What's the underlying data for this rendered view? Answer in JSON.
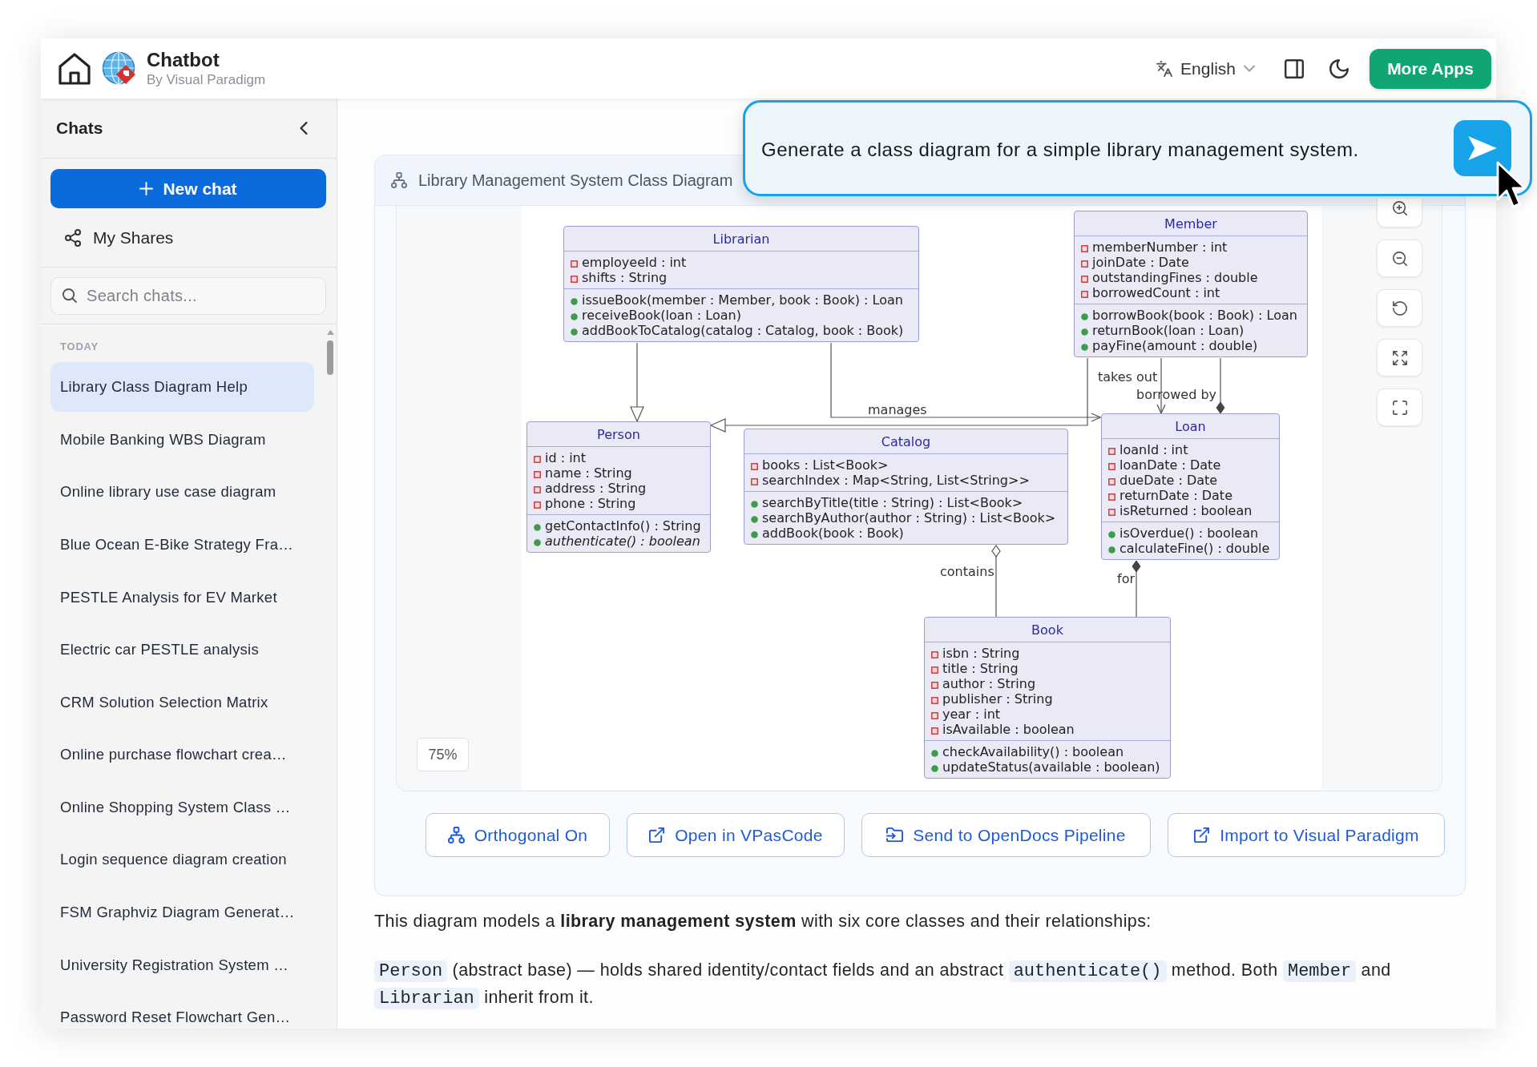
{
  "header": {
    "title": "Chatbot",
    "subtitle": "By Visual Paradigm",
    "language": "English",
    "more_apps": "More Apps"
  },
  "sidebar": {
    "title": "Chats",
    "new_chat": "New chat",
    "my_shares": "My Shares",
    "search": {
      "placeholder": "Search chats..."
    },
    "section": "TODAY",
    "items": [
      {
        "label": "Library Class Diagram Help",
        "selected": true
      },
      {
        "label": "Mobile Banking WBS Diagram",
        "selected": false
      },
      {
        "label": "Online library use case diagram",
        "selected": false
      },
      {
        "label": "Blue Ocean E-Bike Strategy Fra…",
        "selected": false
      },
      {
        "label": "PESTLE Analysis for EV Market",
        "selected": false
      },
      {
        "label": "Electric car PESTLE analysis",
        "selected": false
      },
      {
        "label": "CRM Solution Selection Matrix",
        "selected": false
      },
      {
        "label": "Online purchase flowchart crea…",
        "selected": false
      },
      {
        "label": "Online Shopping System Class …",
        "selected": false
      },
      {
        "label": "Login sequence diagram creation",
        "selected": false
      },
      {
        "label": "FSM Graphviz Diagram Generat…",
        "selected": false
      },
      {
        "label": "University Registration System …",
        "selected": false
      },
      {
        "label": "Password Reset Flowchart Gen…",
        "selected": false
      }
    ]
  },
  "prompt": {
    "text": "Generate a class diagram for a simple library management system."
  },
  "diagram": {
    "title": "Library Management System Class Diagram",
    "zoom": "75%",
    "classes": [
      {
        "name": "Librarian",
        "attributes": [
          {
            "text": "employeeId : int",
            "kind": "private"
          },
          {
            "text": "shifts : String",
            "kind": "private"
          }
        ],
        "methods": [
          {
            "text": "issueBook(member : Member, book : Book) : Loan",
            "kind": "public",
            "abstract": false
          },
          {
            "text": "receiveBook(loan : Loan)",
            "kind": "public",
            "abstract": false
          },
          {
            "text": "addBookToCatalog(catalog : Catalog, book : Book)",
            "kind": "public",
            "abstract": false
          }
        ]
      },
      {
        "name": "Member",
        "attributes": [
          {
            "text": "memberNumber : int",
            "kind": "private"
          },
          {
            "text": "joinDate : Date",
            "kind": "private"
          },
          {
            "text": "outstandingFines : double",
            "kind": "private"
          },
          {
            "text": "borrowedCount : int",
            "kind": "private"
          }
        ],
        "methods": [
          {
            "text": "borrowBook(book : Book) : Loan",
            "kind": "public",
            "abstract": false
          },
          {
            "text": "returnBook(loan : Loan)",
            "kind": "public",
            "abstract": false
          },
          {
            "text": "payFine(amount : double)",
            "kind": "public",
            "abstract": false
          }
        ]
      },
      {
        "name": "Person",
        "attributes": [
          {
            "text": "id : int",
            "kind": "private"
          },
          {
            "text": "name : String",
            "kind": "private"
          },
          {
            "text": "address : String",
            "kind": "private"
          },
          {
            "text": "phone : String",
            "kind": "private"
          }
        ],
        "methods": [
          {
            "text": "getContactInfo() : String",
            "kind": "public",
            "abstract": false
          },
          {
            "text": "authenticate() : boolean",
            "kind": "public",
            "abstract": true
          }
        ]
      },
      {
        "name": "Catalog",
        "attributes": [
          {
            "text": "books : List<Book>",
            "kind": "private"
          },
          {
            "text": "searchIndex : Map<String, List<String>>",
            "kind": "private"
          }
        ],
        "methods": [
          {
            "text": "searchByTitle(title : String) : List<Book>",
            "kind": "public",
            "abstract": false
          },
          {
            "text": "searchByAuthor(author : String) : List<Book>",
            "kind": "public",
            "abstract": false
          },
          {
            "text": "addBook(book : Book)",
            "kind": "public",
            "abstract": false
          }
        ]
      },
      {
        "name": "Loan",
        "attributes": [
          {
            "text": "loanId : int",
            "kind": "private"
          },
          {
            "text": "loanDate : Date",
            "kind": "private"
          },
          {
            "text": "dueDate : Date",
            "kind": "private"
          },
          {
            "text": "returnDate : Date",
            "kind": "private"
          },
          {
            "text": "isReturned : boolean",
            "kind": "private"
          }
        ],
        "methods": [
          {
            "text": "isOverdue() : boolean",
            "kind": "public",
            "abstract": false
          },
          {
            "text": "calculateFine() : double",
            "kind": "public",
            "abstract": false
          }
        ]
      },
      {
        "name": "Book",
        "attributes": [
          {
            "text": "isbn : String",
            "kind": "private"
          },
          {
            "text": "title : String",
            "kind": "private"
          },
          {
            "text": "author : String",
            "kind": "private"
          },
          {
            "text": "publisher : String",
            "kind": "private"
          },
          {
            "text": "year : int",
            "kind": "private"
          },
          {
            "text": "isAvailable : boolean",
            "kind": "private"
          }
        ],
        "methods": [
          {
            "text": "checkAvailability() : boolean",
            "kind": "public",
            "abstract": false
          },
          {
            "text": "updateStatus(available : boolean)",
            "kind": "public",
            "abstract": false
          }
        ]
      }
    ],
    "relations": [
      {
        "kind": "generalization"
      },
      {
        "kind": "generalization"
      },
      {
        "kind": "association",
        "label": "manages"
      },
      {
        "kind": "association",
        "label": "takes out"
      },
      {
        "kind": "composition",
        "label": "borrowed by"
      },
      {
        "kind": "aggregation",
        "label": "contains"
      },
      {
        "kind": "composition",
        "label": "for"
      }
    ],
    "actions": [
      "Orthogonal On",
      "Open in VPasCode",
      "Send to OpenDocs Pipeline",
      "Import to Visual Paradigm"
    ]
  },
  "message": {
    "paragraphs": [
      {
        "segments": [
          {
            "kind": "text",
            "text": "This diagram models a **library management system** with six core classes and their relationships:"
          }
        ]
      },
      {
        "segments": [
          {
            "kind": "code",
            "text": "Person"
          },
          {
            "kind": "text",
            "text": " (abstract base) — holds shared identity/contact fields and an abstract "
          },
          {
            "kind": "code",
            "text": "authenticate()"
          },
          {
            "kind": "text",
            "text": " method. Both "
          },
          {
            "kind": "code",
            "text": "Member"
          },
          {
            "kind": "text",
            "text": " and "
          },
          {
            "kind": "code",
            "text": "Librarian"
          },
          {
            "kind": "text",
            "text": " inherit from it."
          }
        ]
      }
    ]
  }
}
